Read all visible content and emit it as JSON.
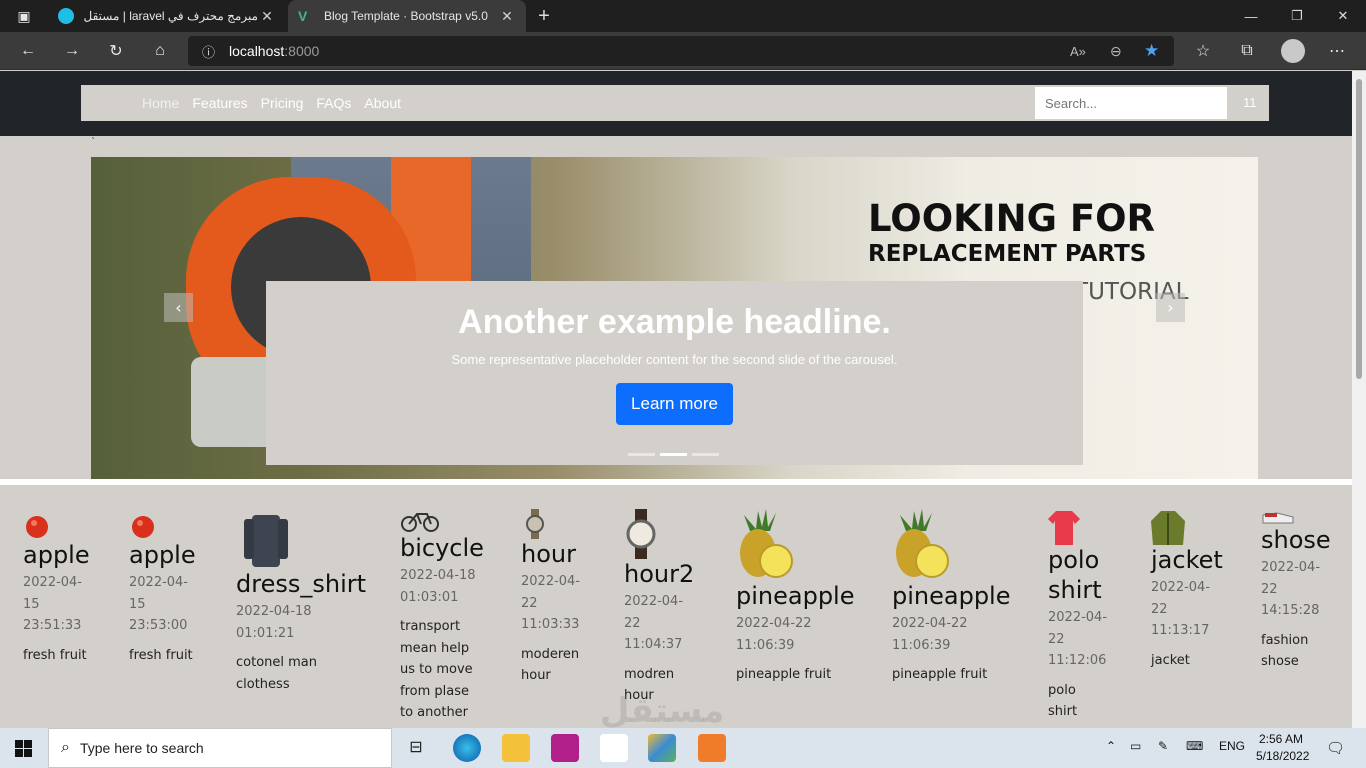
{
  "browser": {
    "tabs": [
      {
        "title": "مبرمج محترف في laravel | مستقل",
        "color": "#1dbfe4"
      },
      {
        "title": "Blog Template · Bootstrap v5.0",
        "color": "#41b883"
      }
    ],
    "address_host": "localhost",
    "address_port": ":8000"
  },
  "nav": {
    "links": [
      "Home",
      "Features",
      "Pricing",
      "FAQs",
      "About"
    ],
    "search_placeholder": "Search...",
    "count": "11"
  },
  "stray_tick": "`",
  "carousel": {
    "ad_line1": "LOOKING FOR",
    "ad_line2": "REPLACEMENT PARTS",
    "ad_line3": "V TUTORIAL",
    "headline": "Another example headline.",
    "text": "Some representative placeholder content for the second slide of the carousel.",
    "button": "Learn more",
    "active_slide": 2,
    "slides_total": 3,
    "prev_icon": "chevron-left-icon",
    "next_icon": "chevron-right-icon",
    "button_color": "#0d6efd"
  },
  "products": [
    {
      "name": "apple",
      "date": "2022-04-15 23:51:33",
      "desc": "fresh fruit",
      "icon": "apple-icon"
    },
    {
      "name": "apple",
      "date": "2022-04-15 23:53:00",
      "desc": "fresh fruit",
      "icon": "apple-icon"
    },
    {
      "name": "dress_shirt",
      "date": "2022-04-18 01:01:21",
      "desc": "cotonel man clothess",
      "icon": "shirt-icon"
    },
    {
      "name": "bicycle",
      "date": "2022-04-18 01:03:01",
      "desc": "transport mean help us to move from plase to another",
      "icon": "bicycle-icon"
    },
    {
      "name": "hour",
      "date": "2022-04-22 11:03:33",
      "desc": "moderen hour",
      "icon": "watch-icon"
    },
    {
      "name": "hour2",
      "date": "2022-04-22 11:04:37",
      "desc": "modren hour",
      "icon": "watch-icon"
    },
    {
      "name": "pineapple",
      "date": "2022-04-22 11:06:39",
      "desc": "pineapple fruit",
      "icon": "pineapple-icon"
    },
    {
      "name": "pineapple",
      "date": "2022-04-22 11:06:39",
      "desc": "pineapple fruit",
      "icon": "pineapple-icon"
    },
    {
      "name": "polo shirt",
      "date": "2022-04-22 11:12:06",
      "desc": "polo shirt",
      "icon": "polo-shirt-icon"
    },
    {
      "name": "jacket",
      "date": "2022-04-22 11:13:17",
      "desc": "jacket",
      "icon": "jacket-icon"
    },
    {
      "name": "shose",
      "date": "2022-04-22 14:15:28",
      "desc": "fashion shose",
      "icon": "shoe-icon"
    }
  ],
  "watermark": "مستقل",
  "taskbar": {
    "search_placeholder": "Type here to search",
    "lang": "ENG",
    "time": "2:56 AM",
    "date": "5/18/2022"
  }
}
